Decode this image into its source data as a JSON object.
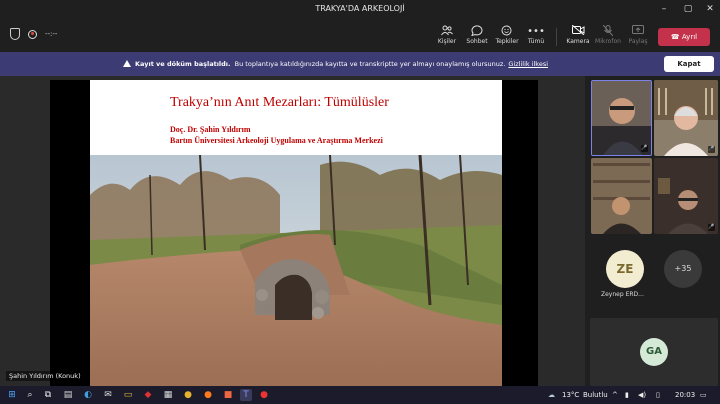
{
  "window": {
    "title": "TRAKYA'DA ARKEOLOJİ",
    "minimize": "–",
    "maximize": "▢",
    "close": "✕"
  },
  "toolbar": {
    "timer": "--:--",
    "people": {
      "label": "Kişiler",
      "icon": "people-icon"
    },
    "chat": {
      "label": "Sohbet",
      "icon": "chat-icon"
    },
    "reactions": {
      "label": "Tepkiler",
      "icon": "reactions-icon"
    },
    "more": {
      "label": "Tümü",
      "icon": "more-icon"
    },
    "camera": {
      "label": "Kamera",
      "icon": "camera-icon"
    },
    "mic": {
      "label": "Mikrofon",
      "icon": "mic-icon"
    },
    "share": {
      "label": "Paylaş",
      "icon": "share-icon"
    },
    "leave": "Ayrıl"
  },
  "banner": {
    "bold": "Kayıt ve döküm başlatıldı.",
    "text": "Bu toplantıya katıldığınızda kayıtta ve transkriptte yer almayı onaylamış olursunuz.",
    "link": "Gizlilik ilkesi",
    "close": "Kapat"
  },
  "slide": {
    "title": "Trakya’nın Anıt Mezarları: Tümülüsler",
    "author": "Doç. Dr. Şahin Yıldırım",
    "affiliation": "Bartın Üniversitesi Arkeoloji Uygulama ve Araştırma Merkezi"
  },
  "speaker": {
    "name": "Şahin Yıldırım (Konuk)"
  },
  "participants": {
    "avatar1": {
      "initials": "ZE",
      "name": "Zeynep ERD..."
    },
    "more": "+35",
    "avatar2": {
      "initials": "GA"
    }
  },
  "taskbar": {
    "weather_temp": "13°C",
    "weather_text": "Bulutlu",
    "time": "20:03"
  },
  "colors": {
    "banner": "#3d3b74",
    "leave": "#c4314b",
    "slide_text": "#c00000"
  }
}
